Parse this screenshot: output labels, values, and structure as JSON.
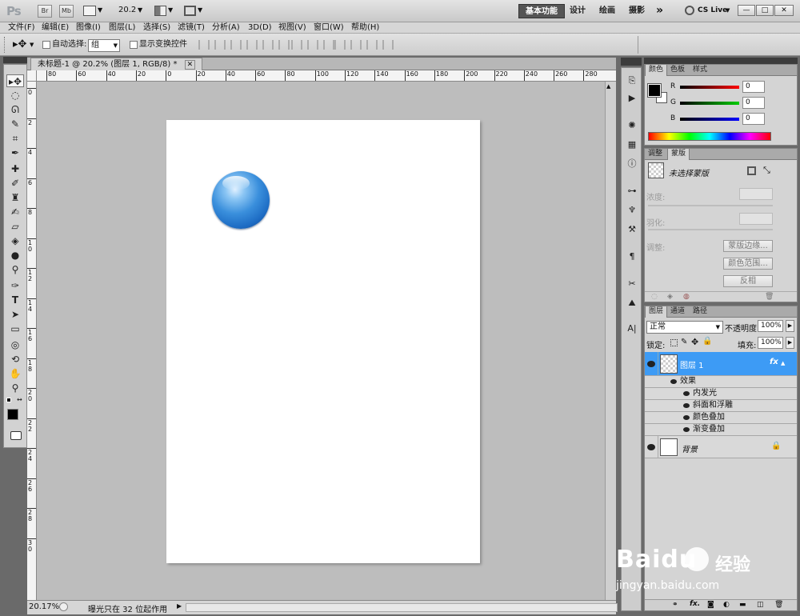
{
  "app": {
    "logo": "Ps",
    "bridge_label": "Br",
    "minibridge_label": "Mb",
    "zoom_select": "20.2",
    "workspaces": [
      "基本功能",
      "设计",
      "绘画",
      "摄影"
    ],
    "more_label": "»",
    "cslive_label": "CS Live",
    "window_buttons": [
      "—",
      "□",
      "✕"
    ]
  },
  "menu": [
    "文件(F)",
    "编辑(E)",
    "图像(I)",
    "图层(L)",
    "选择(S)",
    "滤镜(T)",
    "分析(A)",
    "3D(D)",
    "视图(V)",
    "窗口(W)",
    "帮助(H)"
  ],
  "options": {
    "auto_select_label": "自动选择:",
    "auto_select_value": "组",
    "show_transform_label": "显示变换控件"
  },
  "document": {
    "tab_title": "未标题-1 @ 20.2% (图层 1, RGB/8) *",
    "h_ruler_labels": [
      "80",
      "60",
      "40",
      "20",
      "0",
      "20",
      "40",
      "60",
      "80",
      "100",
      "120",
      "140",
      "160",
      "180",
      "200",
      "220",
      "240",
      "260",
      "280"
    ],
    "v_ruler_labels": [
      "0",
      "2",
      "4",
      "6",
      "8",
      "1 0",
      "1 2",
      "1 4",
      "1 6",
      "1 8",
      "2 0",
      "2 2",
      "2 4",
      "2 6",
      "2 8",
      "3 0"
    ],
    "zoom_status": "20.17%",
    "status_info": "曝光只在 32 位起作用"
  },
  "color_panel": {
    "tabs": [
      "颜色",
      "色板",
      "样式"
    ],
    "channels": [
      {
        "label": "R",
        "value": "0",
        "color": "#d11b1b"
      },
      {
        "label": "G",
        "value": "0",
        "color": "#1aa11a"
      },
      {
        "label": "B",
        "value": "0",
        "color": "#1b1bd1"
      }
    ]
  },
  "masks_panel": {
    "tabs": [
      "调整",
      "蒙版"
    ],
    "no_selection_label": "未选择蒙版",
    "density_label": "浓度:",
    "feather_label": "羽化:",
    "refine_label": "调整:",
    "buttons": [
      "蒙版边缘...",
      "颜色范围...",
      "反相"
    ]
  },
  "layers_panel": {
    "tabs": [
      "图层",
      "通道",
      "路径"
    ],
    "blend_mode": "正常",
    "opacity_label": "不透明度:",
    "opacity_value": "100%",
    "lock_label": "锁定:",
    "fill_label": "填充:",
    "fill_value": "100%",
    "layers": [
      {
        "name": "图层 1",
        "fx_label": "fx",
        "selected": true
      },
      {
        "name": "背景",
        "selected": false
      }
    ],
    "effects_label": "效果",
    "effects": [
      "内发光",
      "斜面和浮雕",
      "颜色叠加",
      "渐变叠加"
    ]
  },
  "watermark": {
    "brand": "Baidu",
    "suffix": "经验",
    "url": "jingyan.baidu.com"
  },
  "colors": {
    "selection_blue": "#3d9bf5",
    "ball_blue": "#2a7fd4"
  }
}
